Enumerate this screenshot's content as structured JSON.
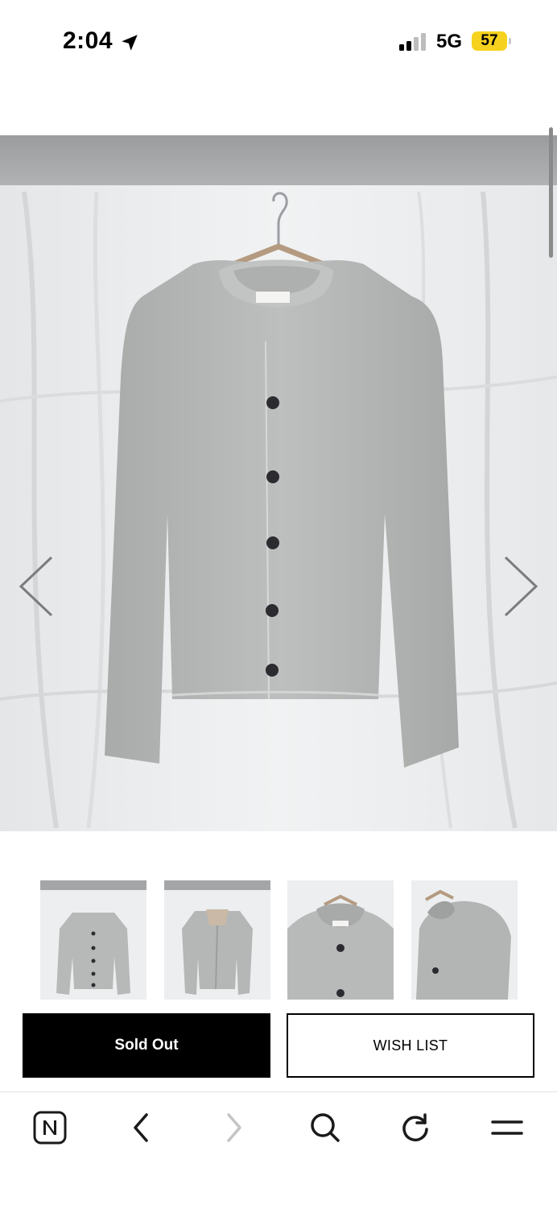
{
  "status_bar": {
    "time": "2:04",
    "network": "5G",
    "battery": "57",
    "location_icon": "location-arrow-icon",
    "signal_icon": "cellular-signal-icon"
  },
  "product": {
    "main_image_alt": "light grey knit cardigan on hanger",
    "thumbnails": [
      "front view",
      "open front view",
      "collar detail",
      "side back view"
    ]
  },
  "actions": {
    "sold_out_label": "Sold Out",
    "wish_list_label": "WISH LIST"
  },
  "toolbar": {
    "items": [
      "naver-app-icon",
      "back-icon",
      "forward-icon",
      "search-icon",
      "refresh-icon",
      "menu-icon"
    ]
  },
  "colors": {
    "battery": "#f6d21f",
    "button_primary": "#000000",
    "cardigan": "#b9bbba",
    "backdrop": "#eceeef"
  }
}
